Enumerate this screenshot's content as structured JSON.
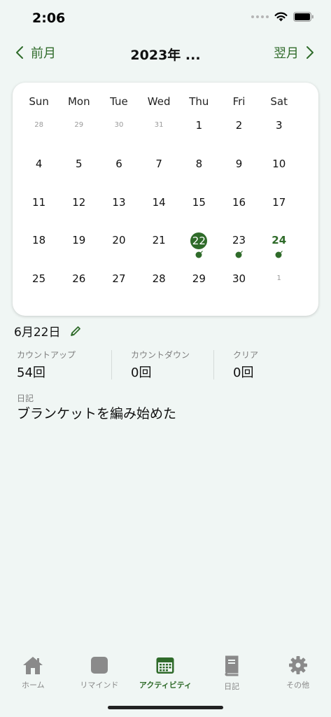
{
  "status_bar": {
    "time": "2:06"
  },
  "nav": {
    "prev_label": "前月",
    "title": "2023年 ...",
    "next_label": "翌月"
  },
  "calendar": {
    "weekdays": [
      "Sun",
      "Mon",
      "Tue",
      "Wed",
      "Thu",
      "Fri",
      "Sat"
    ],
    "weeks": [
      [
        "28",
        "29",
        "30",
        "31",
        "1",
        "2",
        "3"
      ],
      [
        "4",
        "5",
        "6",
        "7",
        "8",
        "9",
        "10"
      ],
      [
        "11",
        "12",
        "13",
        "14",
        "15",
        "16",
        "17"
      ],
      [
        "18",
        "19",
        "20",
        "21",
        "22",
        "23",
        "24"
      ],
      [
        "25",
        "26",
        "27",
        "28",
        "29",
        "30",
        "1"
      ]
    ],
    "selected_day": "22",
    "today_day": "24",
    "activity_days": [
      "22",
      "23",
      "24"
    ],
    "accent_color": "#2f6b2a"
  },
  "detail": {
    "date": "6月22日",
    "stats": [
      {
        "label": "カウントアップ",
        "value": "54回"
      },
      {
        "label": "カウントダウン",
        "value": "0回"
      },
      {
        "label": "クリア",
        "value": "0回"
      }
    ],
    "diary_label": "日記",
    "diary_text": "ブランケットを編み始めた"
  },
  "tabs": [
    {
      "label": "ホーム",
      "icon": "home-icon"
    },
    {
      "label": "リマインド",
      "icon": "remind-icon"
    },
    {
      "label": "アクティビティ",
      "icon": "calendar-icon",
      "active": true
    },
    {
      "label": "日記",
      "icon": "book-icon"
    },
    {
      "label": "その他",
      "icon": "gear-icon"
    }
  ]
}
